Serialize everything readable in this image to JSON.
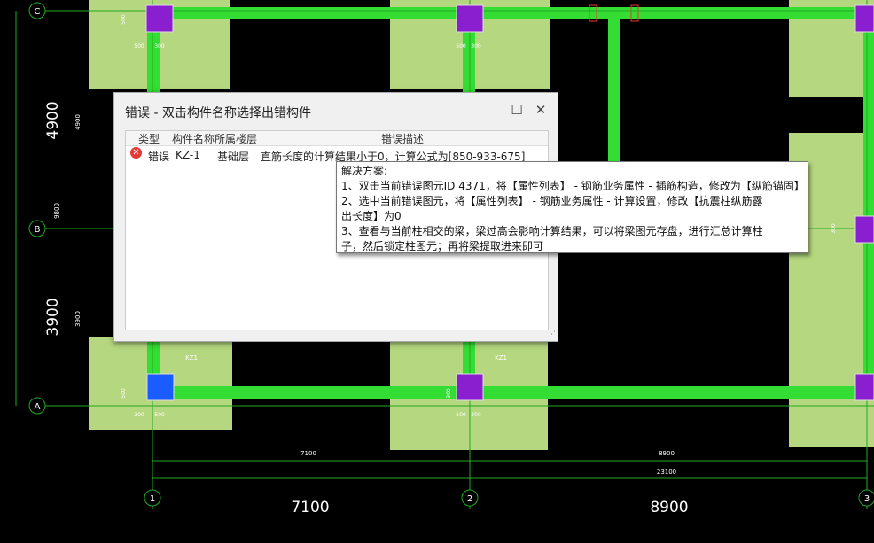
{
  "drawing": {
    "axis_labels": [
      "C",
      "B",
      "A",
      "1",
      "2",
      "3"
    ],
    "span_dims": [
      "4900",
      "3900",
      "7100",
      "8900"
    ],
    "small_dims": [
      "4900",
      "9800",
      "3900",
      "7100",
      "8900",
      "23100"
    ],
    "column_tags": [
      "KZ1",
      "KZ1"
    ],
    "detail_dims": [
      "500",
      "300",
      "500",
      "300",
      "300",
      "500",
      "500",
      "300",
      "500",
      "300",
      "500",
      "300"
    ]
  },
  "colors": {
    "beam": "#33dd33",
    "footing": "#b5d77f",
    "column": "#8a1fcf",
    "column_selected": "#1a5cff",
    "grid_line": "#22aa22",
    "dim_text": "#ffffff"
  },
  "dialog": {
    "title": "错误 - 双击构件名称选择出错构件",
    "columns": [
      "类型",
      "构件名称",
      "所属楼层",
      "错误描述"
    ],
    "rows": [
      {
        "type": "错误",
        "name": "KZ-1",
        "floor": "基础层",
        "desc": "直筋长度的计算结果小于0，计算公式为[850-933-675]"
      }
    ],
    "maximize_icon": "maximize-icon",
    "close_icon": "close-icon"
  },
  "tooltip": {
    "lines": [
      "解决方案:",
      "1、双击当前错误图元ID 4371，将【属性列表】 - 钢筋业务属性 - 插筋构造，修改为【纵筋锚固】",
      "2、选中当前错误图元，将【属性列表】 - 钢筋业务属性 - 计算设置，修改【抗震柱纵筋露",
      "出长度】为0",
      "3、查看与当前柱相交的梁，梁过高会影响计算结果，可以将梁图元存盘，进行汇总计算柱",
      "子，然后锁定柱图元；再将梁提取进来即可"
    ]
  }
}
